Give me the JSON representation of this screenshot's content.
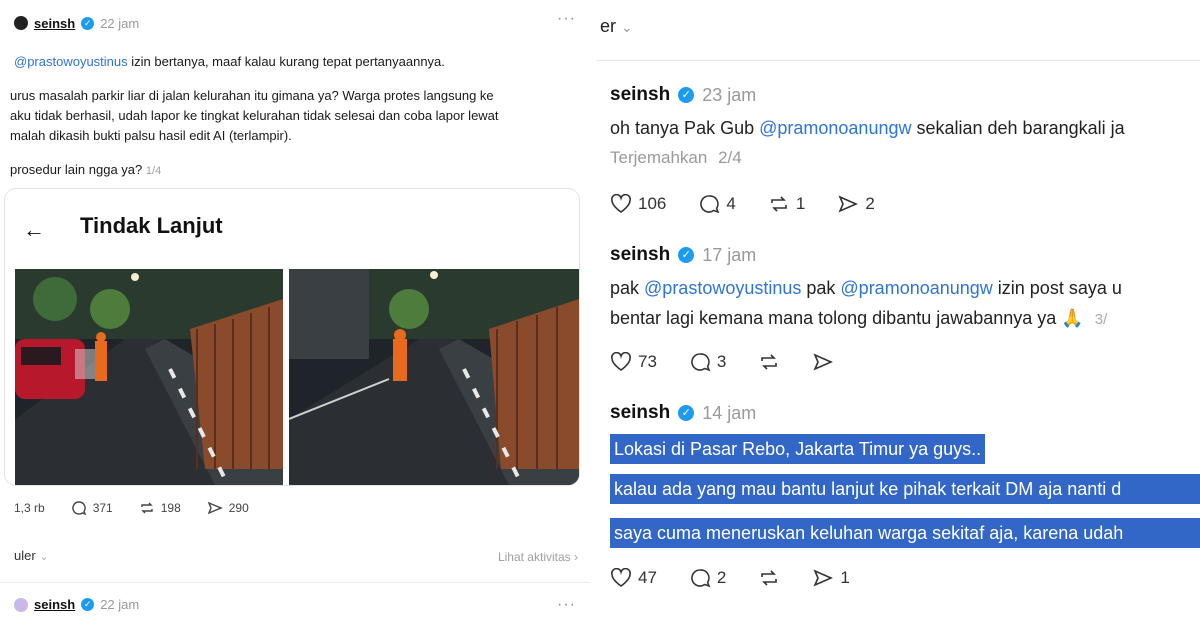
{
  "left_post": {
    "username": "seinsh",
    "time": "22 jam",
    "more": "···",
    "mention": "@prastowoyustinus",
    "line1_rest": " izin bertanya, maaf kalau kurang tepat pertanyaannya.",
    "line2": "urus masalah parkir liar di jalan kelurahan itu gimana ya? Warga protes langsung ke",
    "line3": "aku tidak berhasil, udah lapor ke tingkat kelurahan tidak selesai dan coba lapor lewat",
    "line4": "malah dikasih bukti palsu hasil edit AI (terlampir).",
    "line5": "prosedur lain ngga ya?",
    "page": "1/4",
    "card_back": "←",
    "card_title": "Tindak Lanjut",
    "likes": "1,3 rb",
    "replies": "371",
    "reposts": "198",
    "shares": "290",
    "sort_label": "uler",
    "activity_link": "Lihat aktivitas ›",
    "next_username": "seinsh",
    "next_time": "22 jam"
  },
  "right": {
    "top_label": "er",
    "posts": [
      {
        "username": "seinsh",
        "time": "23 jam",
        "text_pre": "oh tanya Pak Gub ",
        "mention": "@pramonoanungw",
        "text_post": " sekalian deh barangkali ja",
        "translate": "Terjemahkan",
        "page": "2/4",
        "likes": "106",
        "replies": "4",
        "reposts": "1",
        "shares": "2"
      },
      {
        "username": "seinsh",
        "time": "17 jam",
        "line1_a": "pak ",
        "mention1": "@prastowoyustinus",
        "line1_b": " pak ",
        "mention2": "@pramonoanungw",
        "line1_c": " izin post saya u",
        "line2": "bentar lagi kemana mana tolong dibantu jawabannya ya 🙏",
        "page": "3/",
        "likes": "73",
        "replies": "3"
      },
      {
        "username": "seinsh",
        "time": "14 jam",
        "line1": "Lokasi di Pasar Rebo, Jakarta Timur ya guys..",
        "line2": "kalau ada yang mau bantu lanjut ke pihak terkait DM aja nanti d",
        "line3": "saya cuma meneruskan keluhan warga sekitaf aja, karena udah",
        "likes": "47",
        "replies": "2",
        "shares": "1"
      }
    ]
  },
  "colors": {
    "mention": "#2f74d6",
    "verified": "#1d9bf0",
    "highlight": "#3267c8",
    "muted": "#9a9a9a"
  },
  "icons": [
    "heart-icon",
    "comment-icon",
    "repost-icon",
    "share-icon",
    "verified-icon",
    "back-arrow-icon",
    "more-icon",
    "chevron-down-icon"
  ]
}
